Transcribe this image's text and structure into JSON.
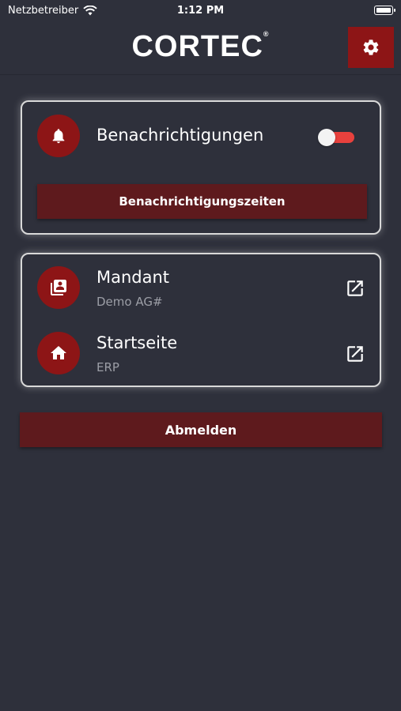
{
  "status_bar": {
    "carrier": "Netzbetreiber",
    "time": "1:12 PM"
  },
  "header": {
    "logo_text": "CORTEC",
    "logo_mark": "®"
  },
  "notifications_card": {
    "label": "Benachrichtigungen",
    "toggle_on": false,
    "times_button_label": "Benachrichtigungszeiten"
  },
  "links_card": {
    "items": [
      {
        "title": "Mandant",
        "subtitle": "Demo AG#",
        "icon": "contacts-icon"
      },
      {
        "title": "Startseite",
        "subtitle": "ERP",
        "icon": "home-icon"
      }
    ]
  },
  "logout_label": "Abmelden",
  "colors": {
    "background": "#2e303b",
    "accent": "#8d1516",
    "button": "#5e1a1d",
    "toggle_track": "#e8413d"
  }
}
